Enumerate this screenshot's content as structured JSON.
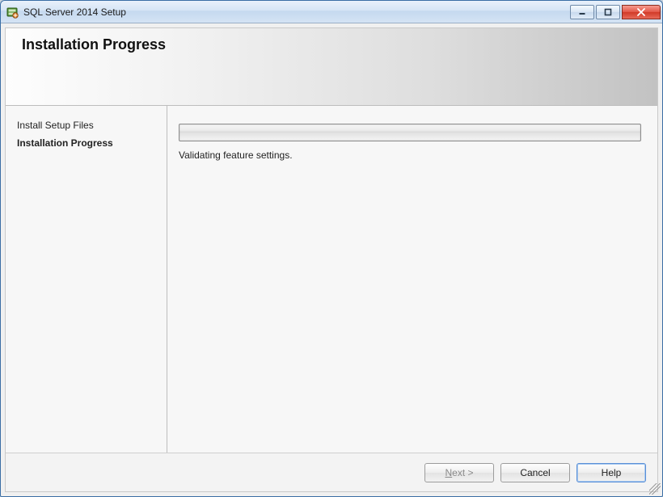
{
  "window": {
    "title": "SQL Server 2014 Setup"
  },
  "header": {
    "title": "Installation Progress"
  },
  "sidebar": {
    "items": [
      {
        "label": "Install Setup Files",
        "active": false
      },
      {
        "label": "Installation Progress",
        "active": true
      }
    ]
  },
  "main": {
    "progress_percent": 0,
    "status": "Validating feature settings."
  },
  "footer": {
    "next_label_prefix": "N",
    "next_label_suffix": "ext >",
    "cancel_label": "Cancel",
    "help_label": "Help"
  }
}
